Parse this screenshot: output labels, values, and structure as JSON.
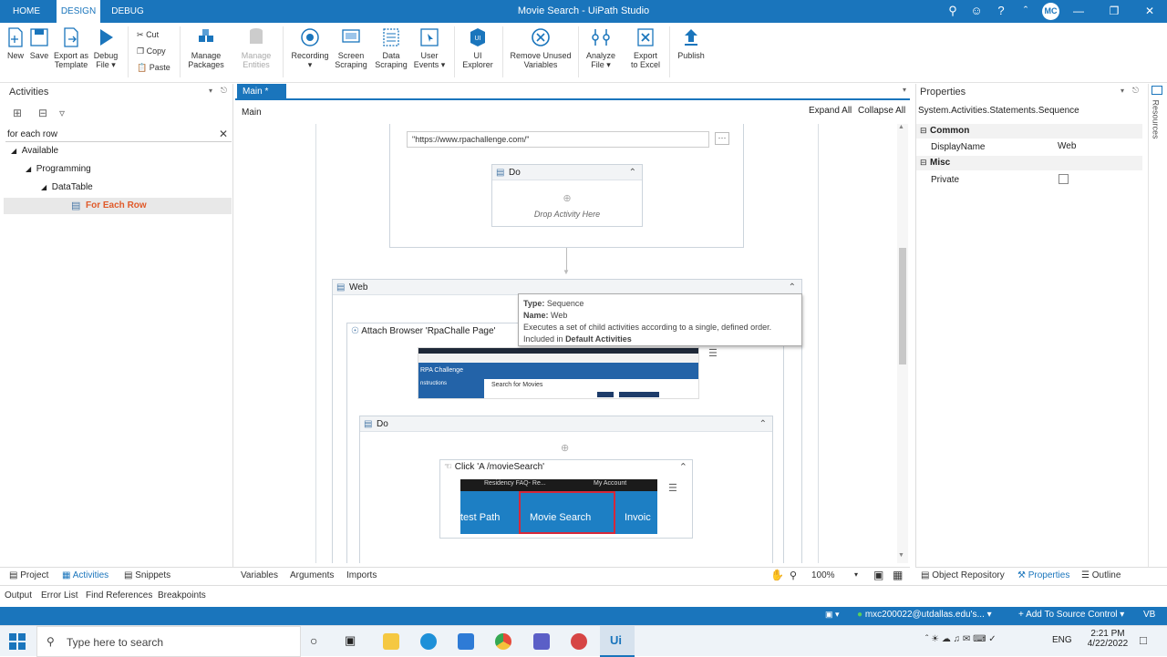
{
  "window": {
    "title": "Movie Search - UiPath Studio",
    "tabs": [
      "HOME",
      "DESIGN",
      "DEBUG"
    ],
    "user_initials": "MC"
  },
  "ribbon": {
    "new": "New",
    "save": "Save",
    "export_template": [
      "Export as",
      "Template"
    ],
    "debug_file": [
      "Debug",
      "File"
    ],
    "cut": "Cut",
    "copy": "Copy",
    "paste": "Paste",
    "manage_packages": [
      "Manage",
      "Packages"
    ],
    "manage_entities": [
      "Manage",
      "Entities"
    ],
    "recording": "Recording",
    "screen_scraping": [
      "Screen",
      "Scraping"
    ],
    "data_scraping": [
      "Data",
      "Scraping"
    ],
    "user_events": [
      "User",
      "Events"
    ],
    "ui_explorer": [
      "UI",
      "Explorer"
    ],
    "remove_unused": [
      "Remove Unused",
      "Variables"
    ],
    "analyze_file": [
      "Analyze",
      "File"
    ],
    "export_excel": [
      "Export",
      "to Excel"
    ],
    "publish": "Publish"
  },
  "activities_panel": {
    "title": "Activities",
    "search_value": "for each row",
    "tree": [
      "Available",
      "Programming",
      "DataTable",
      "For Each Row"
    ]
  },
  "document": {
    "tab": "Main *",
    "breadcrumb": "Main",
    "expand_all": "Expand All",
    "collapse_all": "Collapse All"
  },
  "canvas": {
    "url_value": "\"https://www.rpachallenge.com/\"",
    "do_label": "Do",
    "drop_hint": "Drop Activity Here",
    "web_label": "Web",
    "attach_label": "Attach Browser 'RpaChalle Page'",
    "do2_label": "Do",
    "click_label": "Click 'A  /movieSearch'",
    "shot1_brand": "RPA Challenge",
    "shot1_instr": "nstructions",
    "shot1_search": "Search for Movies",
    "shot2_top1": "Residency FAQ- Re...",
    "shot2_top2": "My Account",
    "shot2_left": "test Path",
    "shot2_mid": "Movie Search",
    "shot2_right": "Invoic"
  },
  "tooltip": {
    "type_key": "Type:",
    "type_val": "Sequence",
    "name_key": "Name:",
    "name_val": "Web",
    "desc": "Executes a set of child activities according to a single, defined order.",
    "included_prefix": "Included in",
    "included_val": "Default Activities"
  },
  "properties": {
    "title": "Properties",
    "class": "System.Activities.Statements.Sequence",
    "common": "Common",
    "display_name_key": "DisplayName",
    "display_name_val": "Web",
    "misc": "Misc",
    "private_key": "Private",
    "side_tab": "Resources"
  },
  "bottom": {
    "variables": "Variables",
    "arguments": "Arguments",
    "imports": "Imports",
    "zoom": "100%",
    "left_tabs": [
      "Project",
      "Activities",
      "Snippets"
    ],
    "right_tabs": [
      "Object Repository",
      "Properties",
      "Outline"
    ],
    "output_tabs": [
      "Output",
      "Error List",
      "Find References",
      "Breakpoints"
    ]
  },
  "status": {
    "account": "mxc200022@utdallas.edu's...",
    "source_control": "Add To Source Control",
    "lang": "VB"
  },
  "taskbar": {
    "search_placeholder": "Type here to search",
    "ui_label": "Ui",
    "lang": "ENG",
    "time": "2:21 PM",
    "date": "4/22/2022"
  }
}
